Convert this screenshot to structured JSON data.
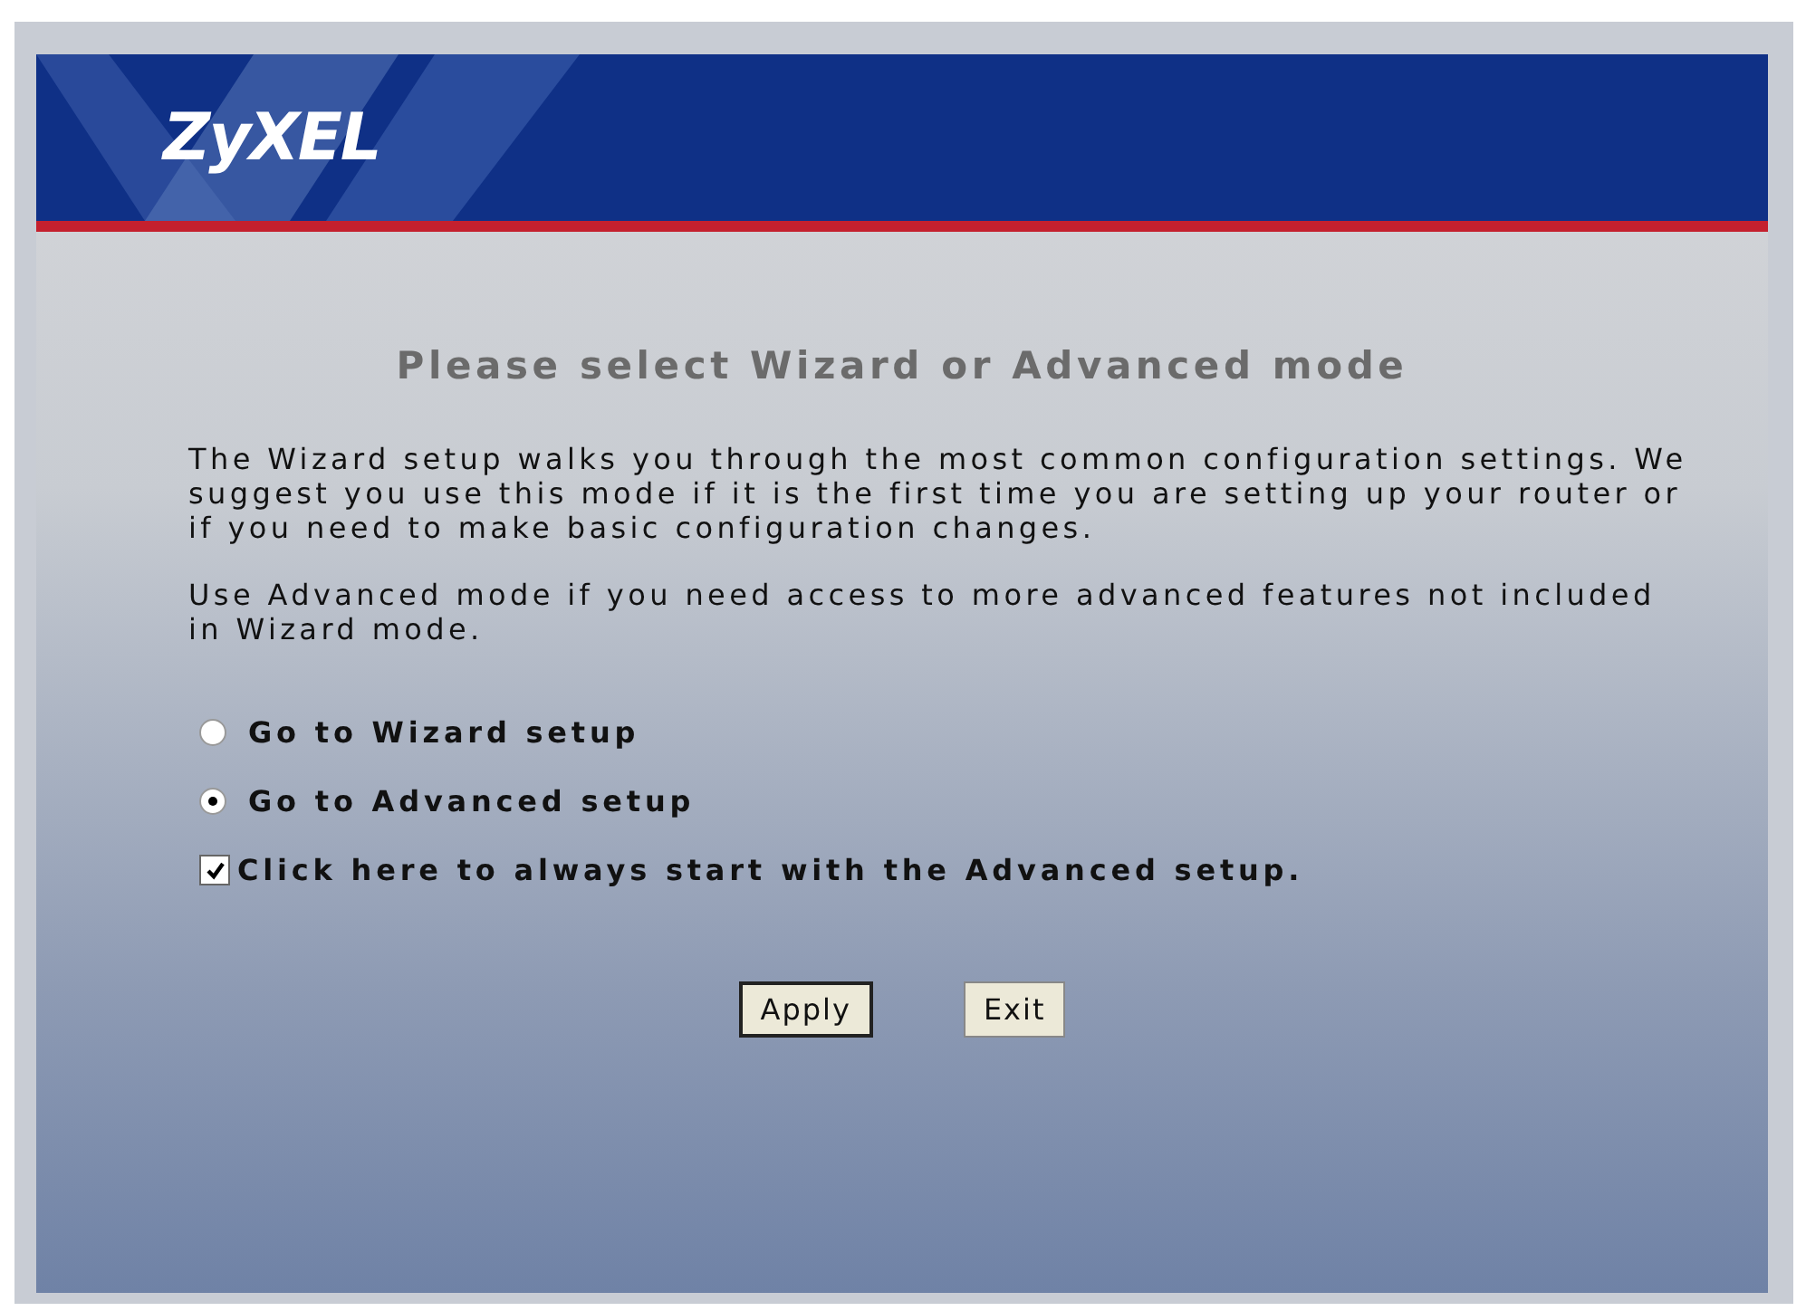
{
  "header": {
    "logo": "ZyXEL"
  },
  "title": "Please select Wizard or Advanced mode",
  "paragraphs": [
    "The Wizard setup walks you through the most common configuration settings. We suggest you use this mode if it is the first time you are setting up your router or if you need to make basic configuration changes.",
    "Use Advanced mode if you need access to more advanced features not included in Wizard mode."
  ],
  "modes": [
    {
      "label": "Go to Wizard setup",
      "selected": false
    },
    {
      "label": "Go to Advanced setup",
      "selected": true
    }
  ],
  "always_start": {
    "label": "Click here to always start with the Advanced setup.",
    "checked": true
  },
  "buttons": [
    {
      "label": "Apply",
      "default": true
    },
    {
      "label": "Exit",
      "default": false
    }
  ]
}
